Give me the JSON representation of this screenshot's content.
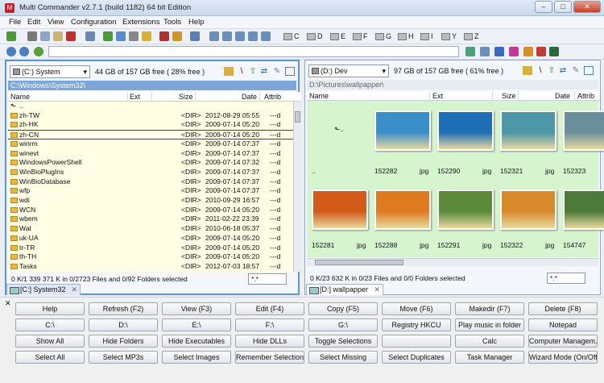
{
  "window": {
    "title": "Multi Commander v2.7.1 (build 1182) 64 bit Edition",
    "app_icon_glyph": "M"
  },
  "menu": [
    "File",
    "Edit",
    "View",
    "Configuration",
    "Extensions",
    "Tools",
    "Help"
  ],
  "drives": [
    "C",
    "D",
    "E",
    "F",
    "G",
    "H",
    "I",
    "Y",
    "Z"
  ],
  "left": {
    "drive": "(C:) System",
    "free": "44 GB of 157 GB free ( 28% free )",
    "path": "C:\\Windows\\System32\\",
    "columns": [
      "Name",
      "Ext",
      "Size",
      "Date",
      "Attrib"
    ],
    "rows": [
      {
        "name": "..",
        "size": "",
        "date": "",
        "attr": ""
      },
      {
        "name": "zh-TW",
        "size": "<DIR>",
        "date": "2012-08-29 05:55",
        "attr": "---d"
      },
      {
        "name": "zh-HK",
        "size": "<DIR>",
        "date": "2009-07-14 05:20",
        "attr": "---d"
      },
      {
        "name": "zh-CN",
        "size": "<DIR>",
        "date": "2009-07-14 05:20",
        "attr": "---d"
      },
      {
        "name": "winrm",
        "size": "<DIR>",
        "date": "2009-07-14 07:37",
        "attr": "---d"
      },
      {
        "name": "winevt",
        "size": "<DIR>",
        "date": "2009-07-14 07:37",
        "attr": "---d"
      },
      {
        "name": "WindowsPowerShell",
        "size": "<DIR>",
        "date": "2009-07-14 07:32",
        "attr": "---d"
      },
      {
        "name": "WinBioPlugIns",
        "size": "<DIR>",
        "date": "2009-07-14 07:37",
        "attr": "---d"
      },
      {
        "name": "WinBioDatabase",
        "size": "<DIR>",
        "date": "2009-07-14 07:37",
        "attr": "---d"
      },
      {
        "name": "wfp",
        "size": "<DIR>",
        "date": "2009-07-14 07:37",
        "attr": "---d"
      },
      {
        "name": "wdi",
        "size": "<DIR>",
        "date": "2010-09-29 16:57",
        "attr": "---d"
      },
      {
        "name": "WCN",
        "size": "<DIR>",
        "date": "2009-07-14 05:20",
        "attr": "---d"
      },
      {
        "name": "wbem",
        "size": "<DIR>",
        "date": "2011-02-22 23:39",
        "attr": "---d"
      },
      {
        "name": "Wat",
        "size": "<DIR>",
        "date": "2010-06-18 05:37",
        "attr": "---d"
      },
      {
        "name": "uk-UA",
        "size": "<DIR>",
        "date": "2009-07-14 05:20",
        "attr": "---d"
      },
      {
        "name": "tr-TR",
        "size": "<DIR>",
        "date": "2009-07-14 05:20",
        "attr": "---d"
      },
      {
        "name": "th-TH",
        "size": "<DIR>",
        "date": "2009-07-14 05:20",
        "attr": "---d"
      },
      {
        "name": "Tasks",
        "size": "<DIR>",
        "date": "2012-07-03 18:57",
        "attr": "---d"
      }
    ],
    "status": "0 K/1 339 371 K in 0/2723 Files and 0/92 Folders selected",
    "filter": "*.*",
    "tab": "[C:] System32"
  },
  "right": {
    "drive": "(D:) Dev",
    "free": "97 GB of 157 GB free ( 61% free )",
    "path": "D:\\Pictures\\wallpapper\\",
    "columns": [
      "Name",
      "Ext",
      "Size",
      "Date",
      "Attrib"
    ],
    "thumbs_row1": [
      {
        "name": "..",
        "ext": "",
        "color": "#d6f5cf"
      },
      {
        "name": "152282",
        "ext": "jpg",
        "color": "#3a8fc8"
      },
      {
        "name": "152290",
        "ext": "jpg",
        "color": "#1f6fb8"
      },
      {
        "name": "152321",
        "ext": "jpg",
        "color": "#4c98a8"
      },
      {
        "name": "152323",
        "ext": "jpg",
        "color": "#6b8f9a"
      }
    ],
    "thumbs_row2": [
      {
        "name": "152281",
        "ext": "jpg",
        "color": "#d45a1a"
      },
      {
        "name": "152288",
        "ext": "jpg",
        "color": "#e07a20"
      },
      {
        "name": "152291",
        "ext": "jpg",
        "color": "#5a8a3a"
      },
      {
        "name": "152322",
        "ext": "jpg",
        "color": "#d98a2a"
      },
      {
        "name": "154747",
        "ext": "jpg",
        "color": "#4c7a3a"
      }
    ],
    "status": "0 K/23 632 K in 0/23 Files and 0/0 Folders selected",
    "filter": "*.*",
    "tab": "[D:] wallpapper"
  },
  "buttons": [
    [
      "Help",
      "Refresh (F2)",
      "View (F3)",
      "Edit (F4)",
      "Copy (F5)",
      "Move (F6)",
      "Makedir (F7)",
      "Delete (F8)"
    ],
    [
      "C:\\",
      "D:\\",
      "E:\\",
      "F:\\",
      "G:\\",
      "Registry HKCU",
      "Play music in folder",
      "Notepad"
    ],
    [
      "Show All",
      "Hide Folders",
      "Hide Executables",
      "Hide DLLs",
      "Toggle Selections",
      "",
      "Calc",
      "Computer Managem..."
    ],
    [
      "Select All",
      "Select MP3s",
      "Select Images",
      "Remember Selection",
      "Select Missing",
      "Select Duplicates",
      "Task Manager",
      "Wizard Mode (On/Off)"
    ]
  ]
}
